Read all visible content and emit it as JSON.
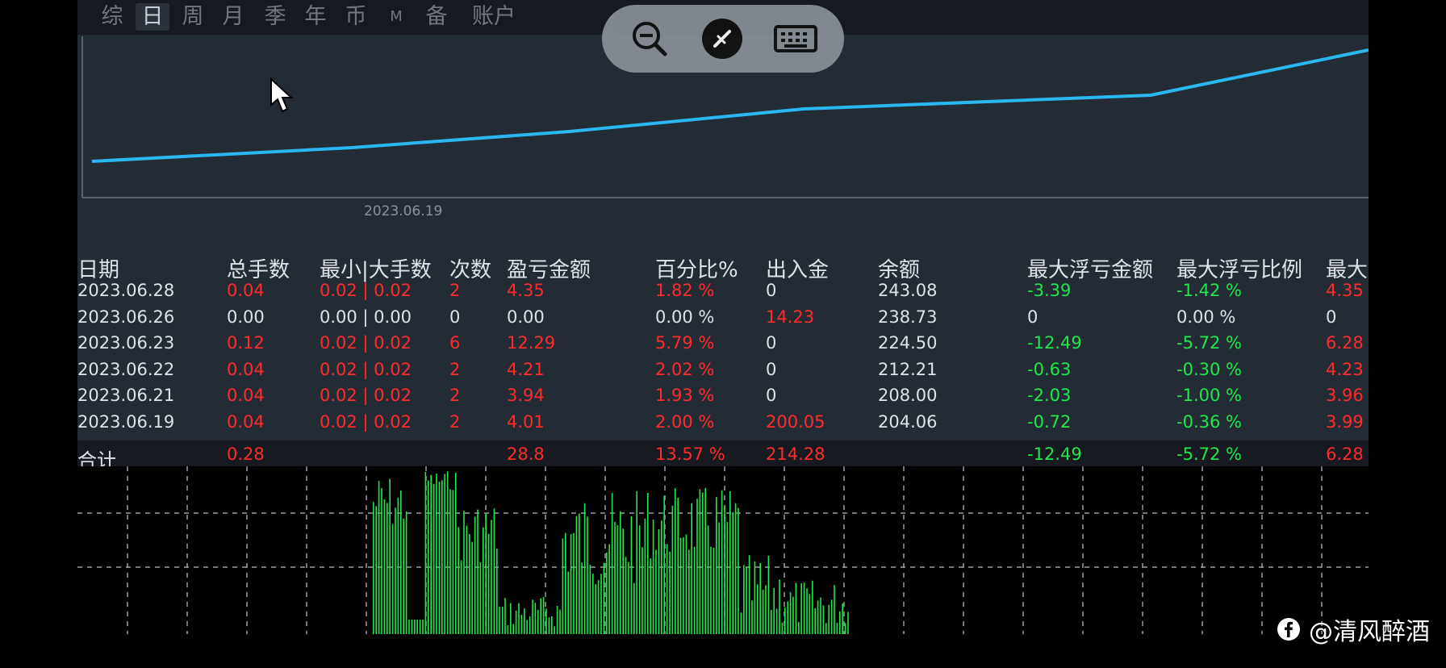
{
  "tabs": [
    {
      "label": "综",
      "active": false
    },
    {
      "label": "日",
      "active": true
    },
    {
      "label": "周",
      "active": false
    },
    {
      "label": "月",
      "active": false
    },
    {
      "label": "季",
      "active": false
    },
    {
      "label": "年",
      "active": false
    },
    {
      "label": "币",
      "active": false
    },
    {
      "label": "M",
      "active": false
    },
    {
      "label": "备",
      "active": false
    },
    {
      "label": "账户",
      "active": false
    }
  ],
  "equity_chart": {
    "date_label": "2023.06.19",
    "line_color": "#2ab8f0",
    "balances": [
      204.06,
      208.0,
      212.21,
      224.5,
      238.73,
      243.08
    ]
  },
  "table": {
    "headers": [
      "日期",
      "总手数",
      "最小|大手数",
      "次数",
      "盈亏金额",
      "百分比%",
      "出入金",
      "余额",
      "最大浮亏金额",
      "最大浮亏比例",
      "最大"
    ],
    "rows": [
      {
        "date": "2023.06.28",
        "lots": "0.04",
        "minmax": "0.02 | 0.02",
        "count": "2",
        "pl": "4.35",
        "pct": "1.82 %",
        "io": "0",
        "balance": "243.08",
        "maxdd": "-3.39",
        "maxdd_pct": "-1.42 %",
        "last": "4.35"
      },
      {
        "date": "2023.06.26",
        "lots": "0.00",
        "minmax": "0.00 | 0.00",
        "count": "0",
        "pl": "0.00",
        "pct": "0.00 %",
        "io": "14.23",
        "balance": "238.73",
        "maxdd": "0",
        "maxdd_pct": "0.00 %",
        "last": "0"
      },
      {
        "date": "2023.06.23",
        "lots": "0.12",
        "minmax": "0.02 | 0.02",
        "count": "6",
        "pl": "12.29",
        "pct": "5.79 %",
        "io": "0",
        "balance": "224.50",
        "maxdd": "-12.49",
        "maxdd_pct": "-5.72 %",
        "last": "6.28"
      },
      {
        "date": "2023.06.22",
        "lots": "0.04",
        "minmax": "0.02 | 0.02",
        "count": "2",
        "pl": "4.21",
        "pct": "2.02 %",
        "io": "0",
        "balance": "212.21",
        "maxdd": "-0.63",
        "maxdd_pct": "-0.30 %",
        "last": "4.23"
      },
      {
        "date": "2023.06.21",
        "lots": "0.04",
        "minmax": "0.02 | 0.02",
        "count": "2",
        "pl": "3.94",
        "pct": "1.93 %",
        "io": "0",
        "balance": "208.00",
        "maxdd": "-2.03",
        "maxdd_pct": "-1.00 %",
        "last": "3.96"
      },
      {
        "date": "2023.06.19",
        "lots": "0.04",
        "minmax": "0.02 | 0.02",
        "count": "2",
        "pl": "4.01",
        "pct": "2.00 %",
        "io": "200.05",
        "balance": "204.06",
        "maxdd": "-0.72",
        "maxdd_pct": "-0.36 %",
        "last": "3.99"
      }
    ],
    "total": {
      "label": "合计",
      "lots": "0.28",
      "pl": "28.8",
      "pct": "13.57 %",
      "io": "214.28",
      "maxdd": "-12.49",
      "maxdd_pct": "-5.72 %",
      "last": "6.28"
    }
  },
  "colors": {
    "positive": "#ff2a2a",
    "negative": "#1ee84a",
    "neutral": "#dfe3e8",
    "volume": "#1ee84a"
  },
  "toolbar_icons": [
    "zoom-out-icon",
    "disconnect-icon",
    "keyboard-icon"
  ],
  "watermark": {
    "text": "@清风醉酒",
    "icon": "facebook-icon"
  }
}
